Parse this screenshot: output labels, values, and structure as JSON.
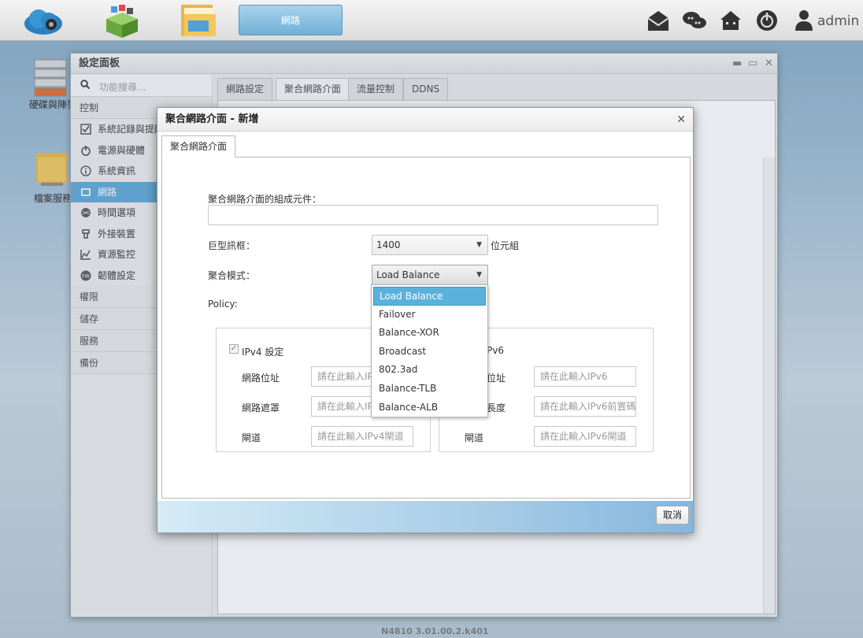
{
  "taskbar": {
    "icons": [
      "cloud-icon",
      "packages-icon",
      "folder-icon"
    ],
    "active_task": "網路",
    "right_icons": [
      "mail-icon",
      "chat-icon",
      "house-icon",
      "power-icon",
      "user-icon"
    ],
    "user": "admin"
  },
  "desktop": {
    "icons": [
      {
        "label": "硬碟與陣列"
      },
      {
        "label": "檔案服務"
      }
    ]
  },
  "settings_window": {
    "title": "設定面板",
    "search_placeholder": "功能搜尋...",
    "sections": {
      "control": "控制",
      "privilege": "權限",
      "storage": "儲存",
      "service": "服務",
      "backup": "備份"
    },
    "control_items": [
      {
        "label": "系統記錄與提醒",
        "icon": "checklist-icon"
      },
      {
        "label": "電源與硬體",
        "icon": "power-icon"
      },
      {
        "label": "系統資訊",
        "icon": "info-icon"
      },
      {
        "label": "網路",
        "icon": "network-icon"
      },
      {
        "label": "時間選項",
        "icon": "globe-icon"
      },
      {
        "label": "外接裝置",
        "icon": "usb-icon"
      },
      {
        "label": "資源監控",
        "icon": "chart-icon"
      },
      {
        "label": "韌體設定",
        "icon": "firmware-icon"
      }
    ],
    "tabs": [
      "網路設定",
      "聚合網路介面",
      "流量控制",
      "DDNS"
    ]
  },
  "dialog": {
    "title": "聚合網路介面 - 新增",
    "tab": "聚合網路介面",
    "member_label": "聚合網路介面的組成元件：",
    "jumbo_label": "巨型訊框：",
    "jumbo_value": "1400",
    "jumbo_unit": "位元組",
    "mode_label": "聚合模式：",
    "mode_value": "Load Balance",
    "mode_options": [
      "Load Balance",
      "Failover",
      "Balance-XOR",
      "Broadcast",
      "802.3ad",
      "Balance-TLB",
      "Balance-ALB"
    ],
    "policy_label": "Policy:",
    "ipv4": {
      "title": "IPv4 設定",
      "rows": [
        {
          "label": "網路位址",
          "placeholder": "請在此輸入IPv4位址"
        },
        {
          "label": "網路遮罩",
          "placeholder": "請在此輸入IPv4遮罩"
        },
        {
          "label": "閘道",
          "placeholder": "請在此輸入IPv4閘道"
        }
      ]
    },
    "ipv6": {
      "title": "Pv6",
      "rows": [
        {
          "label": "位址",
          "placeholder": "請在此輸入IPv6"
        },
        {
          "label": "長度",
          "placeholder": "請在此輸入IPv6前置碼"
        },
        {
          "label": "閘道",
          "placeholder": "請在此輸入IPv6閘道"
        }
      ]
    },
    "cancel_label": "取消"
  },
  "footer": {
    "version": "N4810   3.01.00.2.k401"
  }
}
